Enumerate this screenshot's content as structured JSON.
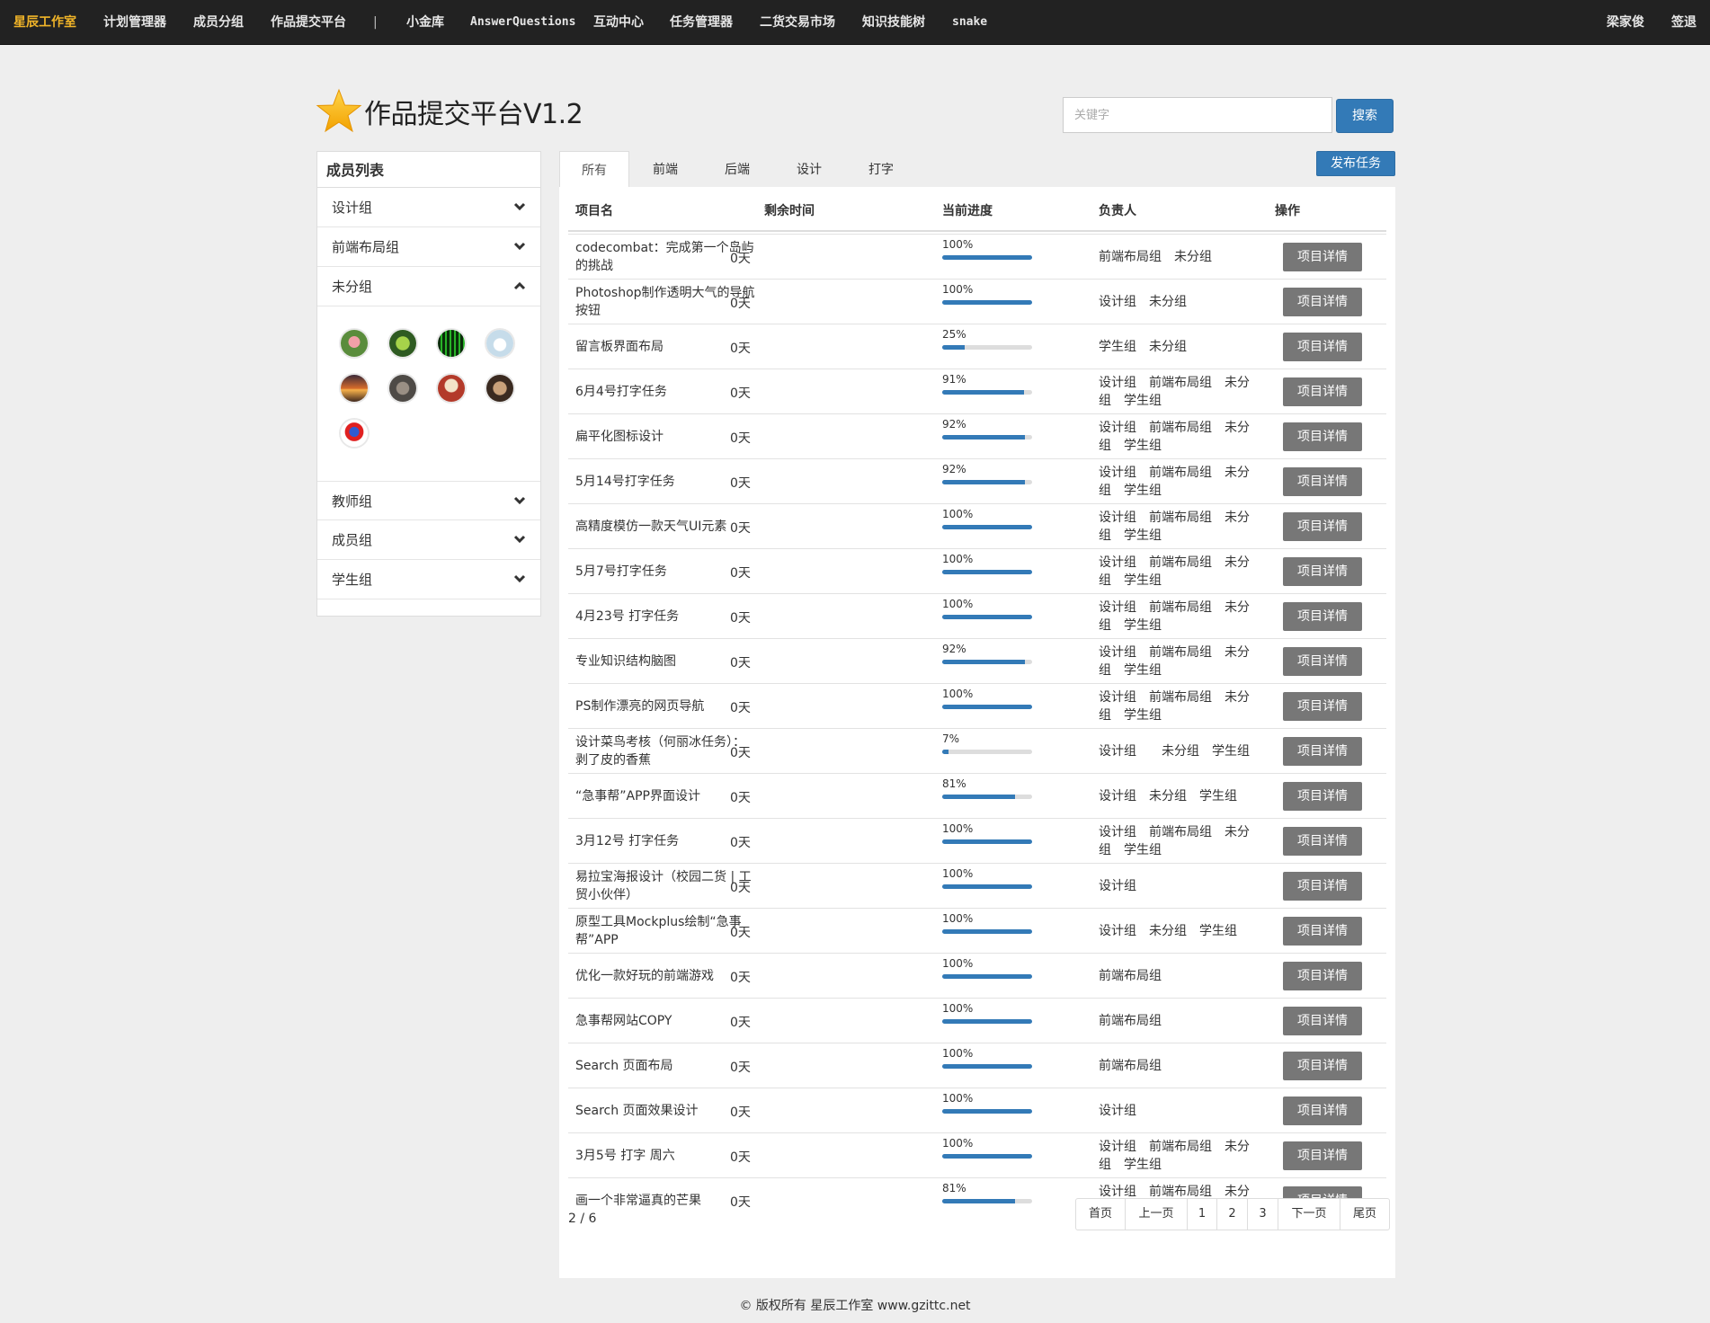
{
  "nav": {
    "brand": "星辰工作室",
    "items": [
      "计划管理器",
      "成员分组",
      "作品提交平台",
      "|",
      "小金库",
      "AnswerQuestions",
      "互动中心",
      "任务管理器",
      "二货交易市场",
      "知识技能树",
      "snake"
    ],
    "user": "梁家俊",
    "signout": "签退"
  },
  "header": {
    "title": "作品提交平台V1.2",
    "search_placeholder": "关键字",
    "search_button": "搜索",
    "publish_button": "发布任务"
  },
  "sidebar": {
    "title": "成员列表",
    "groups": [
      "设计组",
      "前端布局组",
      "未分组",
      "教师组",
      "成员组",
      "学生组"
    ]
  },
  "tabs": [
    "所有",
    "前端",
    "后端",
    "设计",
    "打字"
  ],
  "table": {
    "headers": [
      "项目名",
      "剩余时间",
      "当前进度",
      "负责人",
      "操作"
    ],
    "detail_label": "项目详情",
    "rows": [
      {
        "name": "codecombat：完成第一个岛屿的挑战",
        "time": "0天",
        "pct": "100%",
        "progress": 100,
        "owner": "前端布局组　未分组"
      },
      {
        "name": "Photoshop制作透明大气的导航按钮",
        "time": "0天",
        "pct": "100%",
        "progress": 100,
        "owner": "设计组　未分组"
      },
      {
        "name": "留言板界面布局",
        "time": "0天",
        "pct": "25%",
        "progress": 25,
        "owner": "学生组　未分组"
      },
      {
        "name": "6月4号打字任务",
        "time": "0天",
        "pct": "91%",
        "progress": 91,
        "owner": "设计组　前端布局组　未分组　学生组"
      },
      {
        "name": "扁平化图标设计",
        "time": "0天",
        "pct": "92%",
        "progress": 92,
        "owner": "设计组　前端布局组　未分组　学生组"
      },
      {
        "name": "5月14号打字任务",
        "time": "0天",
        "pct": "92%",
        "progress": 92,
        "owner": "设计组　前端布局组　未分组　学生组"
      },
      {
        "name": "高精度模仿一款天气UI元素",
        "time": "0天",
        "pct": "100%",
        "progress": 100,
        "owner": "设计组　前端布局组　未分组　学生组"
      },
      {
        "name": "5月7号打字任务",
        "time": "0天",
        "pct": "100%",
        "progress": 100,
        "owner": "设计组　前端布局组　未分组　学生组"
      },
      {
        "name": "4月23号 打字任务",
        "time": "0天",
        "pct": "100%",
        "progress": 100,
        "owner": "设计组　前端布局组　未分组　学生组"
      },
      {
        "name": "专业知识结构脑图",
        "time": "0天",
        "pct": "92%",
        "progress": 92,
        "owner": "设计组　前端布局组　未分组　学生组"
      },
      {
        "name": "PS制作漂亮的网页导航",
        "time": "0天",
        "pct": "100%",
        "progress": 100,
        "owner": "设计组　前端布局组　未分组　学生组"
      },
      {
        "name": "设计菜鸟考核（何丽冰任务）：剥了皮的香蕉",
        "time": "0天",
        "pct": "7%",
        "progress": 7,
        "owner": "设计组　　未分组　学生组"
      },
      {
        "name": "“急事帮”APP界面设计",
        "time": "0天",
        "pct": "81%",
        "progress": 81,
        "owner": "设计组　未分组　学生组"
      },
      {
        "name": "3月12号 打字任务",
        "time": "0天",
        "pct": "100%",
        "progress": 100,
        "owner": "设计组　前端布局组　未分组　学生组"
      },
      {
        "name": "易拉宝海报设计（校园二货 | 工贸小伙伴）",
        "time": "0天",
        "pct": "100%",
        "progress": 100,
        "owner": "设计组"
      },
      {
        "name": "原型工具Mockplus绘制“急事帮”APP",
        "time": "0天",
        "pct": "100%",
        "progress": 100,
        "owner": "设计组　未分组　学生组"
      },
      {
        "name": "优化一款好玩的前端游戏",
        "time": "0天",
        "pct": "100%",
        "progress": 100,
        "owner": "前端布局组"
      },
      {
        "name": "急事帮网站COPY",
        "time": "0天",
        "pct": "100%",
        "progress": 100,
        "owner": "前端布局组"
      },
      {
        "name": "Search 页面布局",
        "time": "0天",
        "pct": "100%",
        "progress": 100,
        "owner": "前端布局组"
      },
      {
        "name": "Search 页面效果设计",
        "time": "0天",
        "pct": "100%",
        "progress": 100,
        "owner": "设计组"
      },
      {
        "name": "3月5号 打字 周六",
        "time": "0天",
        "pct": "100%",
        "progress": 100,
        "owner": "设计组　前端布局组　未分组　学生组"
      },
      {
        "name": "画一个非常逼真的芒果",
        "time": "0天",
        "pct": "81%",
        "progress": 81,
        "owner": "设计组　前端布局组　未分组　　学生组"
      }
    ]
  },
  "pagination": {
    "info": "2 / 6",
    "buttons": [
      "首页",
      "上一页",
      "1",
      "2",
      "3",
      "下一页",
      "尾页"
    ]
  },
  "footer": "© 版权所有 星辰工作室 www.gzittc.net",
  "colors": {
    "primary": "#337ab7",
    "detail_button": "#777777",
    "nav_bg": "#222222",
    "brand": "#f0b429"
  }
}
